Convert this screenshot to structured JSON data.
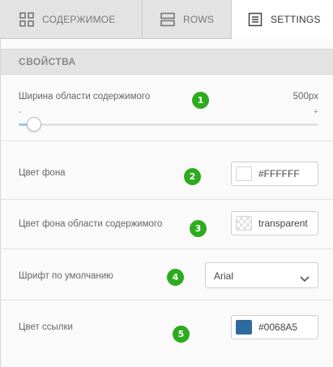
{
  "tabs": [
    {
      "label": "СОДЕРЖИМОЕ",
      "icon": "grid-icon",
      "active": false
    },
    {
      "label": "ROWS",
      "icon": "rows-icon",
      "active": false
    },
    {
      "label": "SETTINGS",
      "icon": "settings-icon",
      "active": true
    }
  ],
  "section": {
    "title": "СВОЙСТВА"
  },
  "settings": {
    "content_width": {
      "label": "Ширина области содержимого",
      "value": "500px",
      "min_label": "-",
      "max_label": "+",
      "slider_fraction": 0.05
    },
    "background_color": {
      "label": "Цвет фона",
      "value": "#FFFFFF",
      "swatch": "#FFFFFF"
    },
    "content_background_color": {
      "label": "Цвет фона области содержимого",
      "value": "transparent"
    },
    "default_font": {
      "label": "Шрифт по умолчанию",
      "value": "Arial"
    },
    "link_color": {
      "label": "Цвет ссылки",
      "value": "#0068A5",
      "swatch": "#2E6A9E"
    }
  },
  "annotations": [
    "1",
    "2",
    "3",
    "4",
    "5"
  ],
  "colors": {
    "accent": "#2EAA1F",
    "tab_bg": "#E3E3E3",
    "slider_fill": "#9FC6E6"
  }
}
